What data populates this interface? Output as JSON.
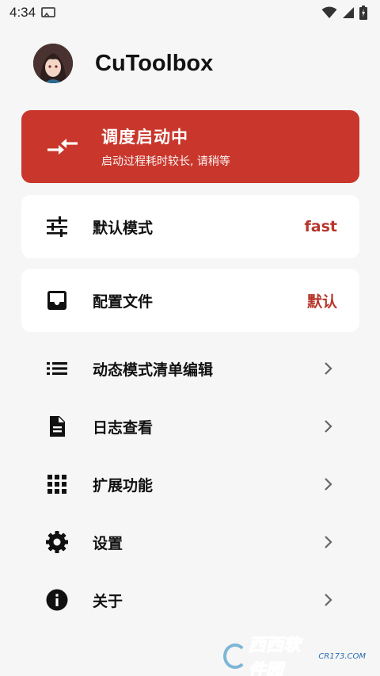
{
  "status_bar": {
    "time": "4:34"
  },
  "header": {
    "title": "CuToolbox"
  },
  "status_card": {
    "title": "调度启动中",
    "subtitle": "启动过程耗时较长, 请稍等",
    "color": "#c9372c"
  },
  "cards": [
    {
      "label": "默认模式",
      "value": "fast",
      "icon": "tune-sliders-icon"
    },
    {
      "label": "配置文件",
      "value": "默认",
      "icon": "inbox-tray-icon"
    }
  ],
  "menu": [
    {
      "label": "动态模式清单编辑",
      "icon": "list-icon"
    },
    {
      "label": "日志查看",
      "icon": "document-icon"
    },
    {
      "label": "扩展功能",
      "icon": "grid-apps-icon"
    },
    {
      "label": "设置",
      "icon": "gear-icon"
    },
    {
      "label": "关于",
      "icon": "info-icon"
    }
  ],
  "watermark": {
    "text": "西西软件园",
    "sub": "CR173.COM"
  },
  "colors": {
    "accent": "#b7362b",
    "background": "#f6f6f6",
    "card": "#ffffff"
  }
}
